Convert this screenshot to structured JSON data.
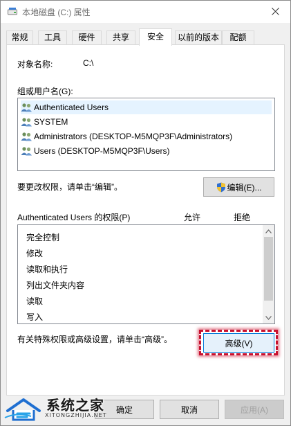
{
  "window": {
    "title": "本地磁盘 (C:) 属性"
  },
  "tabs": [
    {
      "label": "常规",
      "active": false
    },
    {
      "label": "工具",
      "active": false
    },
    {
      "label": "硬件",
      "active": false
    },
    {
      "label": "共享",
      "active": false
    },
    {
      "label": "安全",
      "active": true
    },
    {
      "label": "以前的版本",
      "active": false
    },
    {
      "label": "配额",
      "active": false
    }
  ],
  "security": {
    "object_name_label": "对象名称:",
    "object_name_value": "C:\\",
    "groups_label": "组或用户名(G):",
    "users": [
      {
        "name": "Authenticated Users",
        "selected": true
      },
      {
        "name": "SYSTEM",
        "selected": false
      },
      {
        "name": "Administrators (DESKTOP-M5MQP3F\\Administrators)",
        "selected": false
      },
      {
        "name": "Users (DESKTOP-M5MQP3F\\Users)",
        "selected": false
      }
    ],
    "edit_hint": "要更改权限，请单击“编辑”。",
    "edit_button": "编辑(E)...",
    "permissions_label": "Authenticated Users 的权限(P)",
    "allow_header": "允许",
    "deny_header": "拒绝",
    "permissions": [
      "完全控制",
      "修改",
      "读取和执行",
      "列出文件夹内容",
      "读取",
      "写入"
    ],
    "advanced_hint": "有关特殊权限或高级设置，请单击“高级”。",
    "advanced_button": "高级(V)"
  },
  "footer": {
    "ok_button": "确定",
    "cancel_button": "取消",
    "apply_button": "应用(A)"
  },
  "watermark": {
    "title": "系统之家",
    "subtitle": "XITONGZHIJIA.NET"
  },
  "colors": {
    "highlight": "#c8102e",
    "accent": "#0078d7",
    "selected_row": "#e5f3ff"
  }
}
